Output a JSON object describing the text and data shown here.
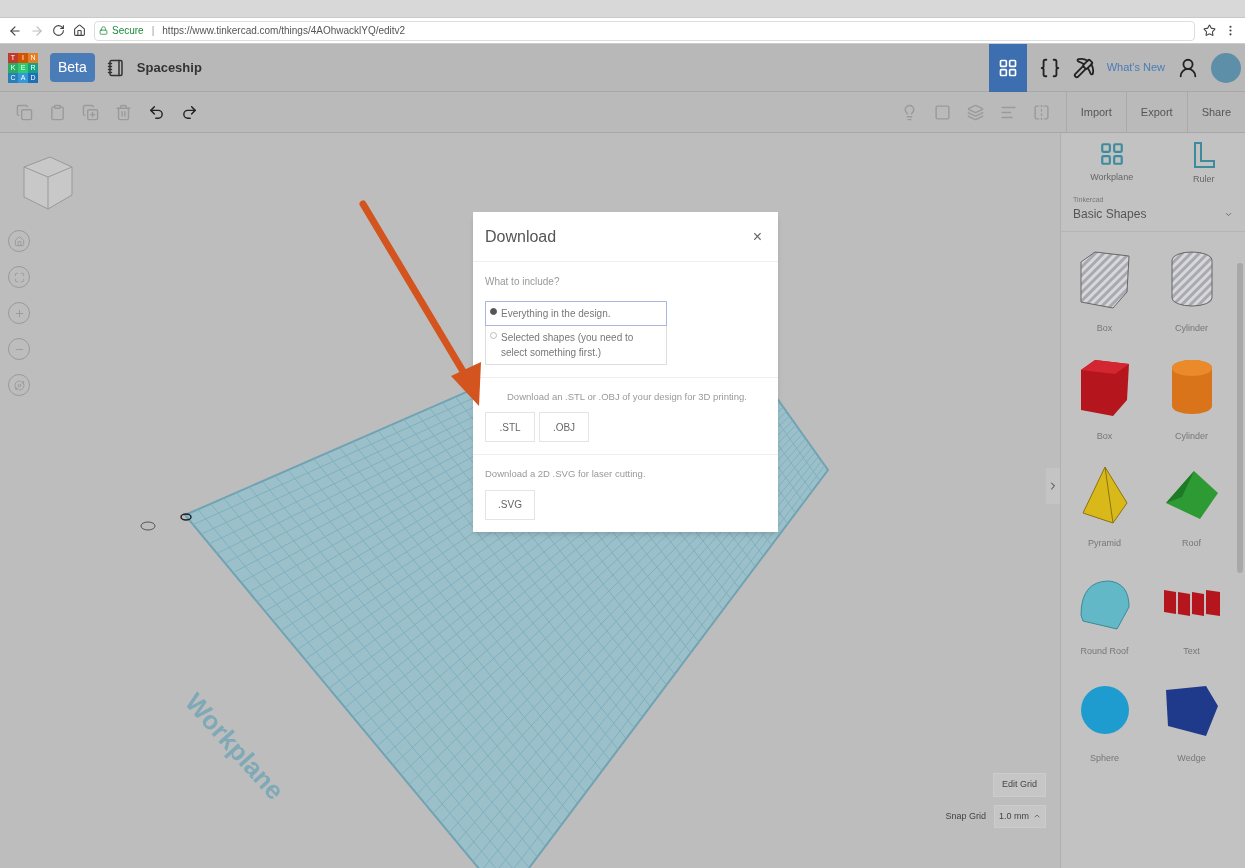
{
  "browser": {
    "secure_label": "Secure",
    "separator": "|",
    "url": "https://www.tinkercad.com/things/4AOhwacklYQ/editv2"
  },
  "header": {
    "logo_letters": [
      "T",
      "I",
      "N",
      "K",
      "E",
      "R",
      "C",
      "A",
      "D"
    ],
    "badge": "Beta",
    "design_name": "Spaceship",
    "whats_new": "What's New"
  },
  "toolbar": {
    "buttons": [
      "Import",
      "Export",
      "Share"
    ]
  },
  "canvas": {
    "workplane_label": "Workplane",
    "edit_grid": "Edit Grid",
    "snap_grid_label": "Snap Grid",
    "snap_grid_value": "1.0 mm"
  },
  "panel": {
    "tools": [
      {
        "kind": "workplane",
        "label": "Workplane"
      },
      {
        "kind": "ruler",
        "label": "Ruler"
      }
    ],
    "library_caption": "Tinkercad",
    "library": "Basic Shapes",
    "shapes": [
      {
        "kind": "box-hole",
        "label": "Box"
      },
      {
        "kind": "cylinder-hole",
        "label": "Cylinder"
      },
      {
        "kind": "box",
        "label": "Box"
      },
      {
        "kind": "cylinder",
        "label": "Cylinder"
      },
      {
        "kind": "pyramid",
        "label": "Pyramid"
      },
      {
        "kind": "roof",
        "label": "Roof"
      },
      {
        "kind": "round-roof",
        "label": "Round Roof"
      },
      {
        "kind": "text",
        "label": "Text"
      },
      {
        "kind": "sphere",
        "label": "Sphere"
      },
      {
        "kind": "wedge",
        "label": "Wedge"
      }
    ]
  },
  "dialog": {
    "title": "Download",
    "close": "×",
    "include_label": "What to include?",
    "options": [
      {
        "label": "Everything in the design.",
        "selected": true
      },
      {
        "label": "Selected shapes (you need to select something first.)",
        "selected": false
      }
    ],
    "sections": [
      {
        "text": "Download an .STL or .OBJ of your design for 3D printing.",
        "buttons": [
          ".STL",
          ".OBJ"
        ]
      },
      {
        "text": "Download a 2D .SVG for laser cutting.",
        "buttons": [
          ".SVG"
        ]
      }
    ]
  }
}
